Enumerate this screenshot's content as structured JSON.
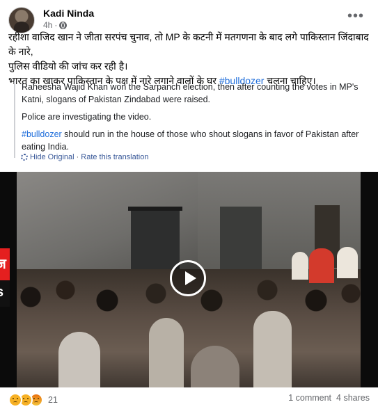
{
  "post": {
    "author": "Kadi Ninda",
    "time": "4h",
    "original_text": {
      "line1": "रहीशा वाजिद खान ने जीता सरपंच चुनाव, तो MP के कटनी में मतगणना के बाद लगे पाकिस्तान जिंदाबाद के नारे,",
      "line2": "पुलिस वीडियो की जांच कर रही है।",
      "line3_before": "भारत का खाकर पाकिस्तान के पक्ष में नारे लगाने वालों के घर ",
      "line3_hashtag": "#bulldozer",
      "line3_after": " चलना चाहिए।"
    },
    "translation": {
      "para1": "Raheesha Wajid Khan won the Sarpanch election, then after counting the votes in MP's Katni, slogans of Pakistan Zindabad were raised.",
      "para2": "Police are investigating the video.",
      "para3_hashtag": "#bulldozer",
      "para3_after": " should run in the house of those who shout slogans in favor of Pakistan after eating India."
    },
    "translation_links": {
      "hide": "Hide Original",
      "separator": "·",
      "rate": "Rate this translation"
    },
    "video": {
      "channel_logo_top": "ज",
      "channel_logo_bottom": "s"
    },
    "footer": {
      "reaction_icons": [
        "sad-icon",
        "wow-icon",
        "angry-icon"
      ],
      "reaction_count": "21",
      "comments": "1 comment",
      "shares": "4 shares"
    }
  }
}
